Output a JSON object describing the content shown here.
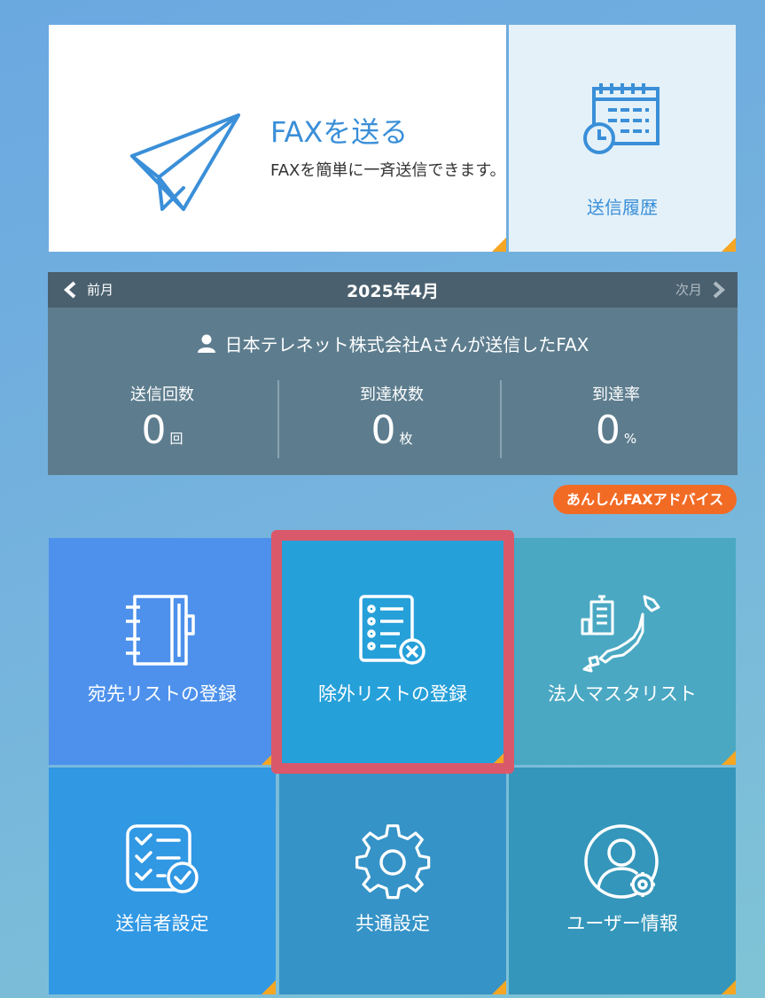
{
  "send_card": {
    "title": "FAXを送る",
    "description": "FAXを簡単に一斉送信できます。"
  },
  "history_card": {
    "label": "送信履歴"
  },
  "stats": {
    "prev": "前月",
    "month": "2025年4月",
    "next": "次月",
    "user_line": "日本テレネット株式会社Aさんが送信したFAX",
    "items": [
      {
        "label": "送信回数",
        "value": "0",
        "unit": "回"
      },
      {
        "label": "到達枚数",
        "value": "0",
        "unit": "枚"
      },
      {
        "label": "到達率",
        "value": "0",
        "unit": "%"
      }
    ]
  },
  "advice_button": "あんしんFAXアドバイス",
  "tiles": [
    {
      "label": "宛先リストの登録"
    },
    {
      "label": "除外リストの登録"
    },
    {
      "label": "法人マスタリスト"
    },
    {
      "label": "送信者設定"
    },
    {
      "label": "共通設定"
    },
    {
      "label": "ユーザー情報"
    }
  ],
  "colors": {
    "accent": "#3a8fd8",
    "corner": "#f5a623",
    "advice": "#f26b25",
    "highlight": "#d9596b"
  }
}
